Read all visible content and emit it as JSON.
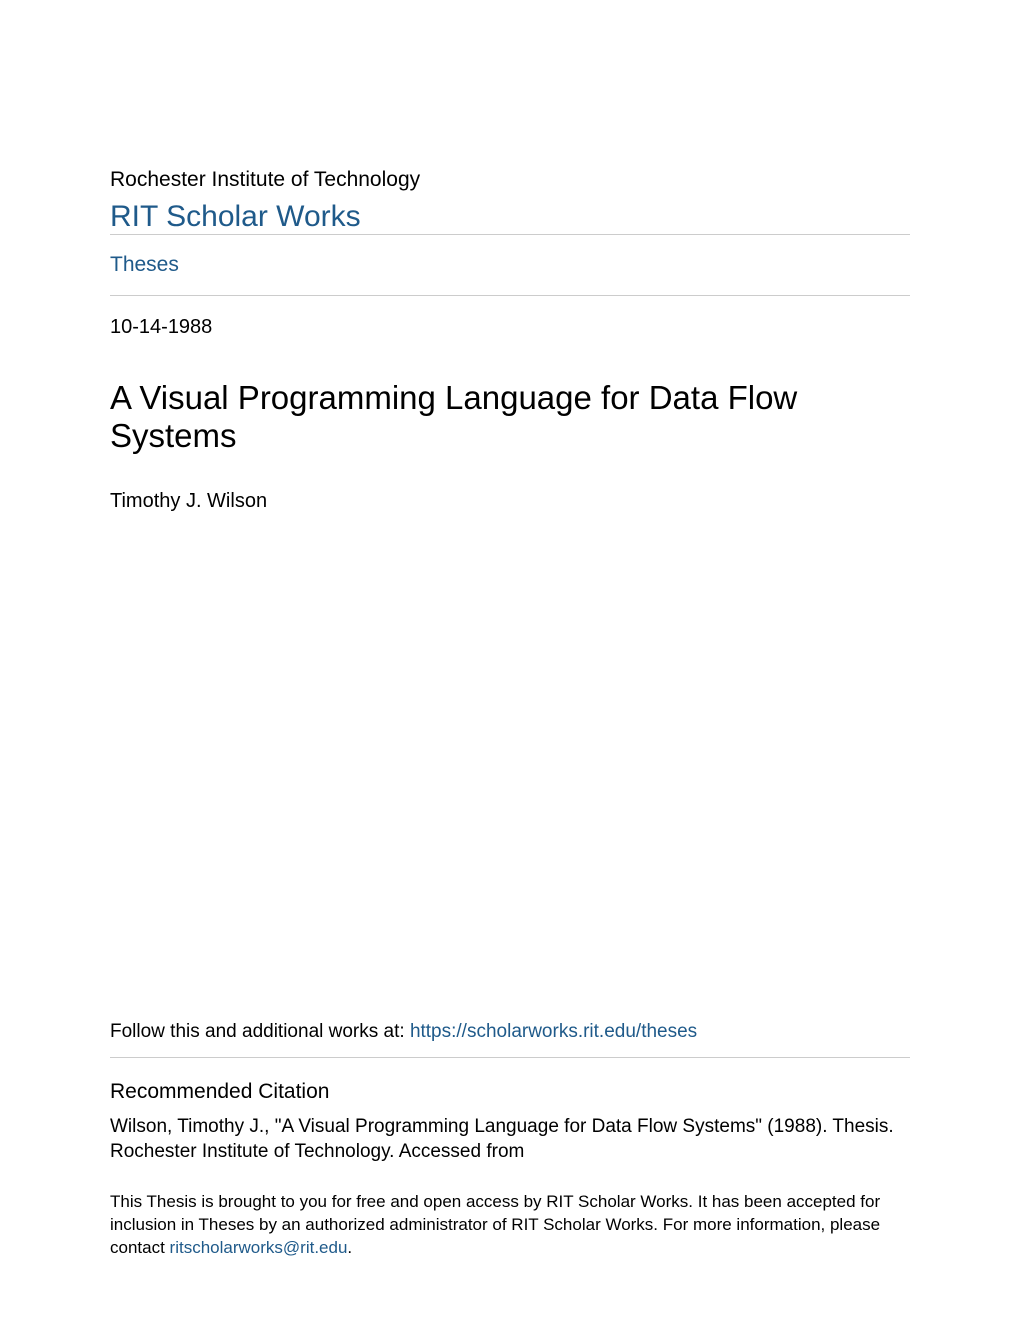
{
  "header": {
    "institution": "Rochester Institute of Technology",
    "site_name": "RIT Scholar Works"
  },
  "collection": {
    "label": "Theses"
  },
  "document": {
    "date": "10-14-1988",
    "title": "A Visual Programming Language for Data Flow Systems",
    "author": "Timothy J. Wilson"
  },
  "follow": {
    "prefix": "Follow this and additional works at: ",
    "link_text": "https://scholarworks.rit.edu/theses"
  },
  "citation": {
    "heading": "Recommended Citation",
    "text": "Wilson, Timothy J., \"A Visual Programming Language for Data Flow Systems\" (1988). Thesis. Rochester Institute of Technology. Accessed from"
  },
  "footer": {
    "access_text": "This Thesis is brought to you for free and open access by RIT Scholar Works. It has been accepted for inclusion in Theses by an authorized administrator of RIT Scholar Works. For more information, please contact ",
    "email": "ritscholarworks@rit.edu",
    "period": "."
  }
}
